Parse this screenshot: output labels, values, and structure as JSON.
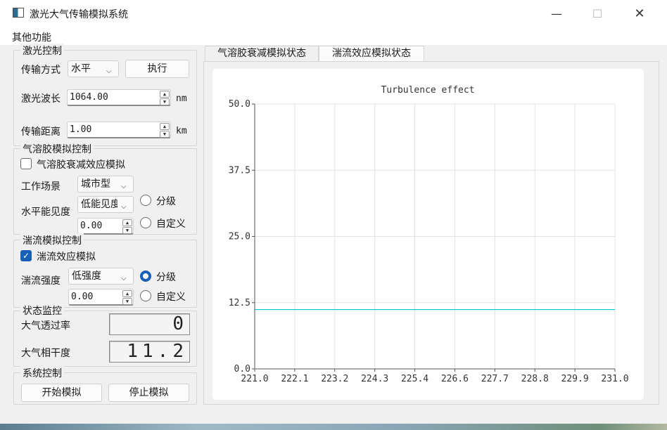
{
  "window": {
    "title": "激光大气传输模拟系统",
    "minimize_glyph": "—",
    "maximize_glyph": "☐",
    "close_glyph": "✕"
  },
  "menu": {
    "other_functions": "其他功能"
  },
  "laser_control": {
    "group_title": "激光控制",
    "transmission_mode_label": "传输方式",
    "transmission_mode_value": "水平",
    "execute_button": "执行",
    "wavelength_label": "激光波长",
    "wavelength_value": "1064.00",
    "wavelength_unit": "nm",
    "distance_label": "传输距离",
    "distance_value": "1.00",
    "distance_unit": "km"
  },
  "aerosol_control": {
    "group_title": "气溶胶模拟控制",
    "enable_label": "气溶胶衰减效应模拟",
    "enabled": false,
    "scene_label": "工作场景",
    "scene_value": "城市型",
    "visibility_label": "水平能见度",
    "visibility_value": "低能见度",
    "visibility_number": "0.00",
    "radio_graded": "分级",
    "radio_custom": "自定义",
    "selected": "none"
  },
  "turbulence_control": {
    "group_title": "湍流模拟控制",
    "enable_label": "湍流效应模拟",
    "enabled": true,
    "strength_label": "湍流强度",
    "strength_value": "低强度",
    "strength_number": "0.00",
    "radio_graded": "分级",
    "radio_custom": "自定义",
    "selected": "graded"
  },
  "status_monitor": {
    "group_title": "状态监控",
    "transmittance_label": "大气透过率",
    "transmittance_value": "0",
    "coherence_label": "大气相干度",
    "coherence_value": "11.2"
  },
  "system_control": {
    "group_title": "系统控制",
    "start_button": "开始模拟",
    "stop_button": "停止模拟"
  },
  "tabs": [
    {
      "label": "气溶胶衰减模拟状态",
      "active": false
    },
    {
      "label": "湍流效应模拟状态",
      "active": true
    }
  ],
  "chart_data": {
    "type": "line",
    "title": "Turbulence effect",
    "xlim": [
      221.0,
      231.0
    ],
    "ylim": [
      0.0,
      50.0
    ],
    "x_ticks": [
      "221.0",
      "222.1",
      "223.2",
      "224.3",
      "225.4",
      "226.6",
      "227.7",
      "228.8",
      "229.9",
      "231.0"
    ],
    "y_ticks": [
      "0.0",
      "12.5",
      "25.0",
      "37.5",
      "50.0"
    ],
    "grid": true,
    "series": [
      {
        "color": "#00c8d2",
        "x": [
          221.0,
          231.0
        ],
        "y": [
          11.2,
          11.2
        ]
      }
    ]
  }
}
